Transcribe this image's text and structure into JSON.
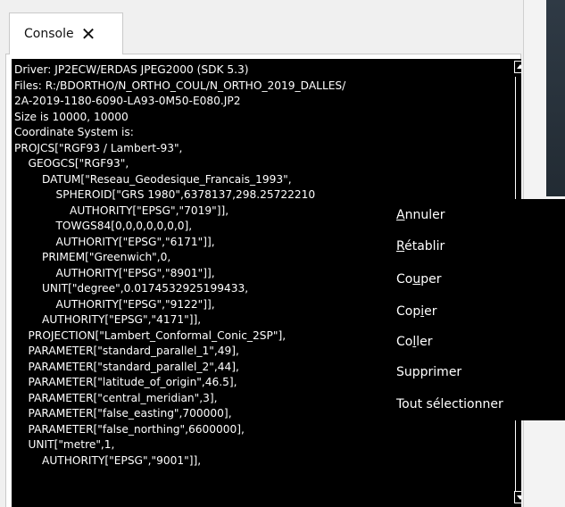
{
  "tab": {
    "label": "Console",
    "close_glyph": "✕"
  },
  "console": {
    "lines": [
      "Driver: JP2ECW/ERDAS JPEG2000 (SDK 5.3)",
      "Files: R:/BDORTHO/N_ORTHO_COUL/N_ORTHO_2019_DALLES/",
      "2A-2019-1180-6090-LA93-0M50-E080.JP2",
      "Size is 10000, 10000",
      "Coordinate System is:",
      "PROJCS[\"RGF93 / Lambert-93\",",
      "    GEOGCS[\"RGF93\",",
      "        DATUM[\"Reseau_Geodesique_Francais_1993\",",
      "            SPHEROID[\"GRS 1980\",6378137,298.25722210",
      "                AUTHORITY[\"EPSG\",\"7019\"]],",
      "            TOWGS84[0,0,0,0,0,0,0],",
      "            AUTHORITY[\"EPSG\",\"6171\"]],",
      "        PRIMEM[\"Greenwich\",0,",
      "            AUTHORITY[\"EPSG\",\"8901\"]],",
      "        UNIT[\"degree\",0.0174532925199433,",
      "            AUTHORITY[\"EPSG\",\"9122\"]],",
      "        AUTHORITY[\"EPSG\",\"4171\"]],",
      "    PROJECTION[\"Lambert_Conformal_Conic_2SP\"],",
      "    PARAMETER[\"standard_parallel_1\",49],",
      "    PARAMETER[\"standard_parallel_2\",44],",
      "    PARAMETER[\"latitude_of_origin\",46.5],",
      "    PARAMETER[\"central_meridian\",3],",
      "    PARAMETER[\"false_easting\",700000],",
      "    PARAMETER[\"false_northing\",6600000],",
      "    UNIT[\"metre\",1,",
      "        AUTHORITY[\"EPSG\",\"9001\"]],"
    ]
  },
  "context_menu": {
    "items": [
      {
        "label": "Annuler",
        "mnemonic_index": 0
      },
      {
        "label": "Rétablir",
        "mnemonic_index": 0
      },
      {
        "label": "Couper",
        "mnemonic_index": 2
      },
      {
        "label": "Copier",
        "mnemonic_index": 3
      },
      {
        "label": "Coller",
        "mnemonic_index": 2
      },
      {
        "label": "Supprimer",
        "mnemonic_index": -1
      },
      {
        "label": "Tout sélectionner",
        "mnemonic_index": -1
      }
    ]
  },
  "colors": {
    "console_bg": "#000000",
    "console_fg": "#ffffff",
    "menu_bg": "#000000",
    "menu_fg": "#ffffff"
  }
}
